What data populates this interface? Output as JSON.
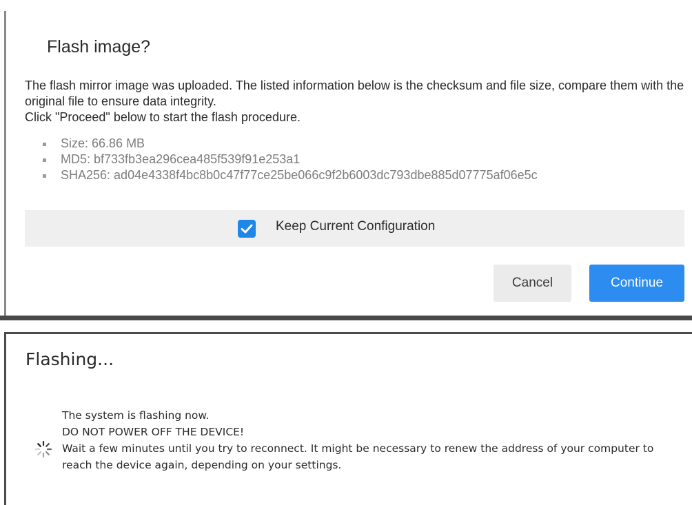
{
  "flash_dialog": {
    "title": "Flash image?",
    "description_line1": "The flash mirror image was uploaded. The listed information below is the checksum and file size, compare them with the original file to ensure data integrity.",
    "description_line2": "Click \"Proceed\" below to start the flash procedure.",
    "details": [
      {
        "text": "Size: 66.86 MB"
      },
      {
        "text": "MD5: bf733fb3ea296cea485f539f91e253a1"
      },
      {
        "text": "SHA256: ad04e4338f4bc8b0c47f77ce25be066c9f2b6003dc793dbe885d07775af06e5c"
      }
    ],
    "keep_config_label": "Keep Current Configuration",
    "keep_config_checked": true,
    "cancel_label": "Cancel",
    "continue_label": "Continue",
    "accent_color": "#2d8cf0"
  },
  "flashing_dialog": {
    "title": "Flashing...",
    "line1": "The system is flashing now.",
    "line2": "DO NOT POWER OFF THE DEVICE!",
    "line3": "Wait a few minutes until you try to reconnect. It might be necessary to renew the address of your computer to reach the device again, depending on your settings.",
    "spinner_icon": "loading-spinner-icon"
  }
}
